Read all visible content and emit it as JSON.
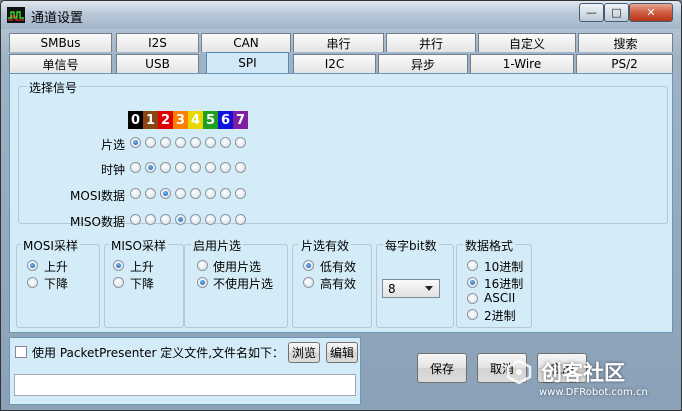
{
  "window": {
    "title": "通道设置",
    "buttons": {
      "minimize": "—",
      "maximize": "□",
      "close": "✕"
    }
  },
  "tabs": {
    "row1": [
      "SMBus",
      "I2S",
      "CAN",
      "串行",
      "并行",
      "自定义",
      "搜索"
    ],
    "row2": [
      "单信号",
      "USB",
      "SPI",
      "I2C",
      "异步",
      "1-Wire",
      "PS/2"
    ],
    "active": "SPI"
  },
  "signal_select": {
    "title": "选择信号",
    "bits": [
      "0",
      "1",
      "2",
      "3",
      "4",
      "5",
      "6",
      "7"
    ],
    "bit_colors": [
      "#000000",
      "#8b4513",
      "#e00000",
      "#ff8000",
      "#e6d800",
      "#20a020",
      "#1010e0",
      "#8020a0"
    ],
    "rows": [
      {
        "label": "片选",
        "selected": 0
      },
      {
        "label": "时钟",
        "selected": 1
      },
      {
        "label": "MOSI数据",
        "selected": 2
      },
      {
        "label": "MISO数据",
        "selected": 3
      }
    ]
  },
  "mosi_sample": {
    "title": "MOSI采样",
    "options": [
      "上升",
      "下降"
    ],
    "selected": 0
  },
  "miso_sample": {
    "title": "MISO采样",
    "options": [
      "上升",
      "下降"
    ],
    "selected": 0
  },
  "cs_enable": {
    "title": "启用片选",
    "options": [
      "使用片选",
      "不使用片选"
    ],
    "selected": 1
  },
  "cs_active": {
    "title": "片选有效",
    "options": [
      "低有效",
      "高有效"
    ],
    "selected": 0
  },
  "bits_per_word": {
    "title": "每字bit数",
    "value": "8"
  },
  "data_format": {
    "title": "数据格式",
    "options": [
      "10进制",
      "16进制",
      "ASCII",
      "2进制"
    ],
    "selected": 1
  },
  "packet_presenter": {
    "checkbox_label": "使用 PacketPresenter 定义文件,文件名如下：",
    "checked": false,
    "browse_label": "浏览",
    "edit_label": "编辑",
    "file_value": ""
  },
  "footer": {
    "save_label": "保存",
    "cancel_label": "取消",
    "apply_label": "应用"
  },
  "watermark": {
    "text": "创客社区",
    "url": "www.DFRobot.com.cn"
  }
}
